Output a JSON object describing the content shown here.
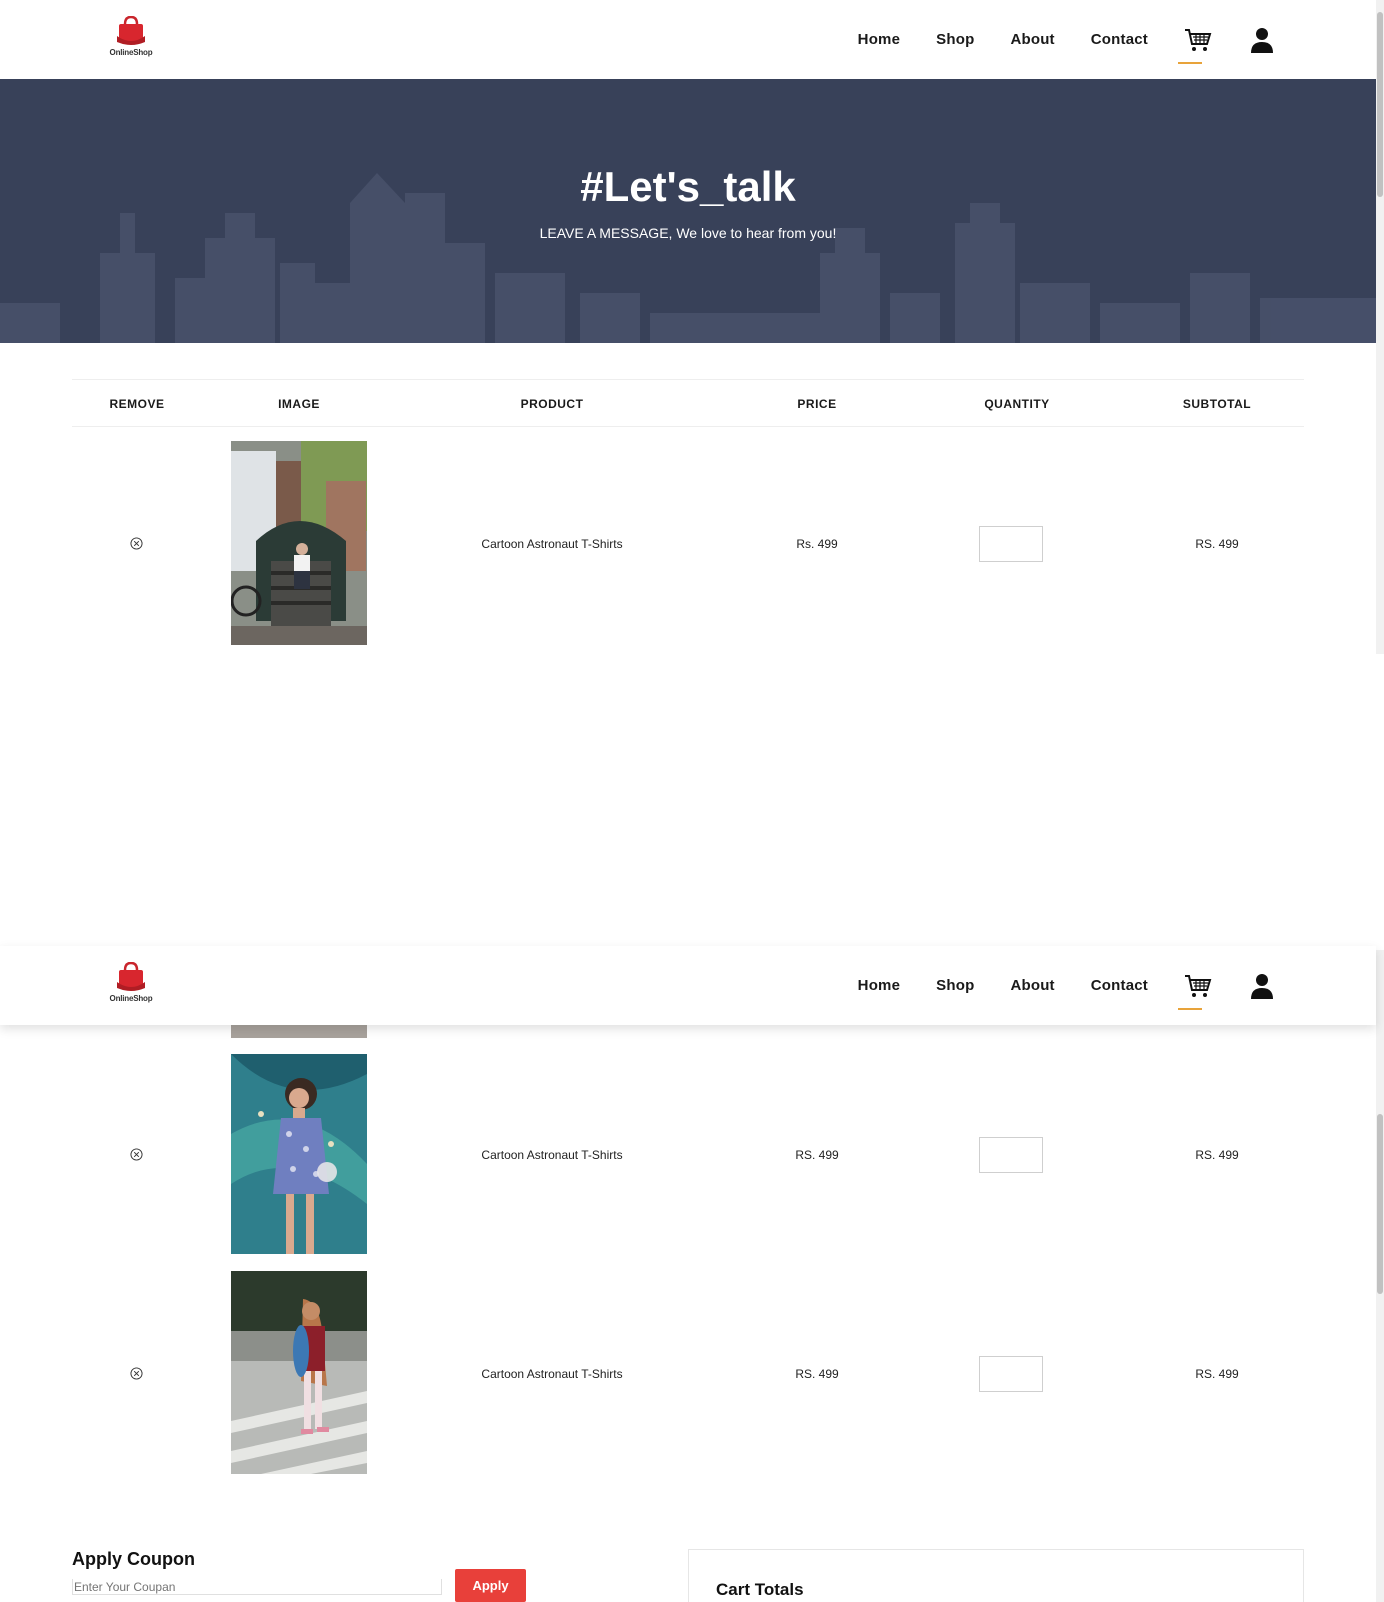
{
  "brand": {
    "name": "OnlineShop",
    "accent": "#e8403a"
  },
  "nav": {
    "links": [
      "Home",
      "Shop",
      "About",
      "Contact"
    ],
    "cart_icon": "cart-icon",
    "user_icon": "user-icon",
    "active_underline": "#e8a33a"
  },
  "banner": {
    "title": "#Let's_talk",
    "subtitle": "LEAVE A MESSAGE, We love to hear from you!",
    "bg": "#384159"
  },
  "table": {
    "headers": [
      "REMOVE",
      "IMAGE",
      "PRODUCT",
      "PRICE",
      "QUANTITY",
      "SUBTOTAL"
    ],
    "rows": [
      {
        "product": "Cartoon Astronaut T-Shirts",
        "price": "Rs. 499",
        "subtotal": "RS. 499",
        "quantity": "",
        "image": "man sitting on bridge steps"
      },
      {
        "product": "Cartoon Astronaut T-Shirts",
        "price": "RS. 499",
        "subtotal": "RS. 499",
        "quantity": "",
        "image": "woman in floral dress by mural"
      },
      {
        "product": "Cartoon Astronaut T-Shirts",
        "price": "RS. 499",
        "subtotal": "RS. 499",
        "quantity": "",
        "image": "girl holding skateboard on crosswalk"
      }
    ]
  },
  "coupon": {
    "title": "Apply Coupon",
    "placeholder": "Enter Your Coupan",
    "button": "Apply"
  },
  "totals": {
    "title": "Cart Totals"
  }
}
